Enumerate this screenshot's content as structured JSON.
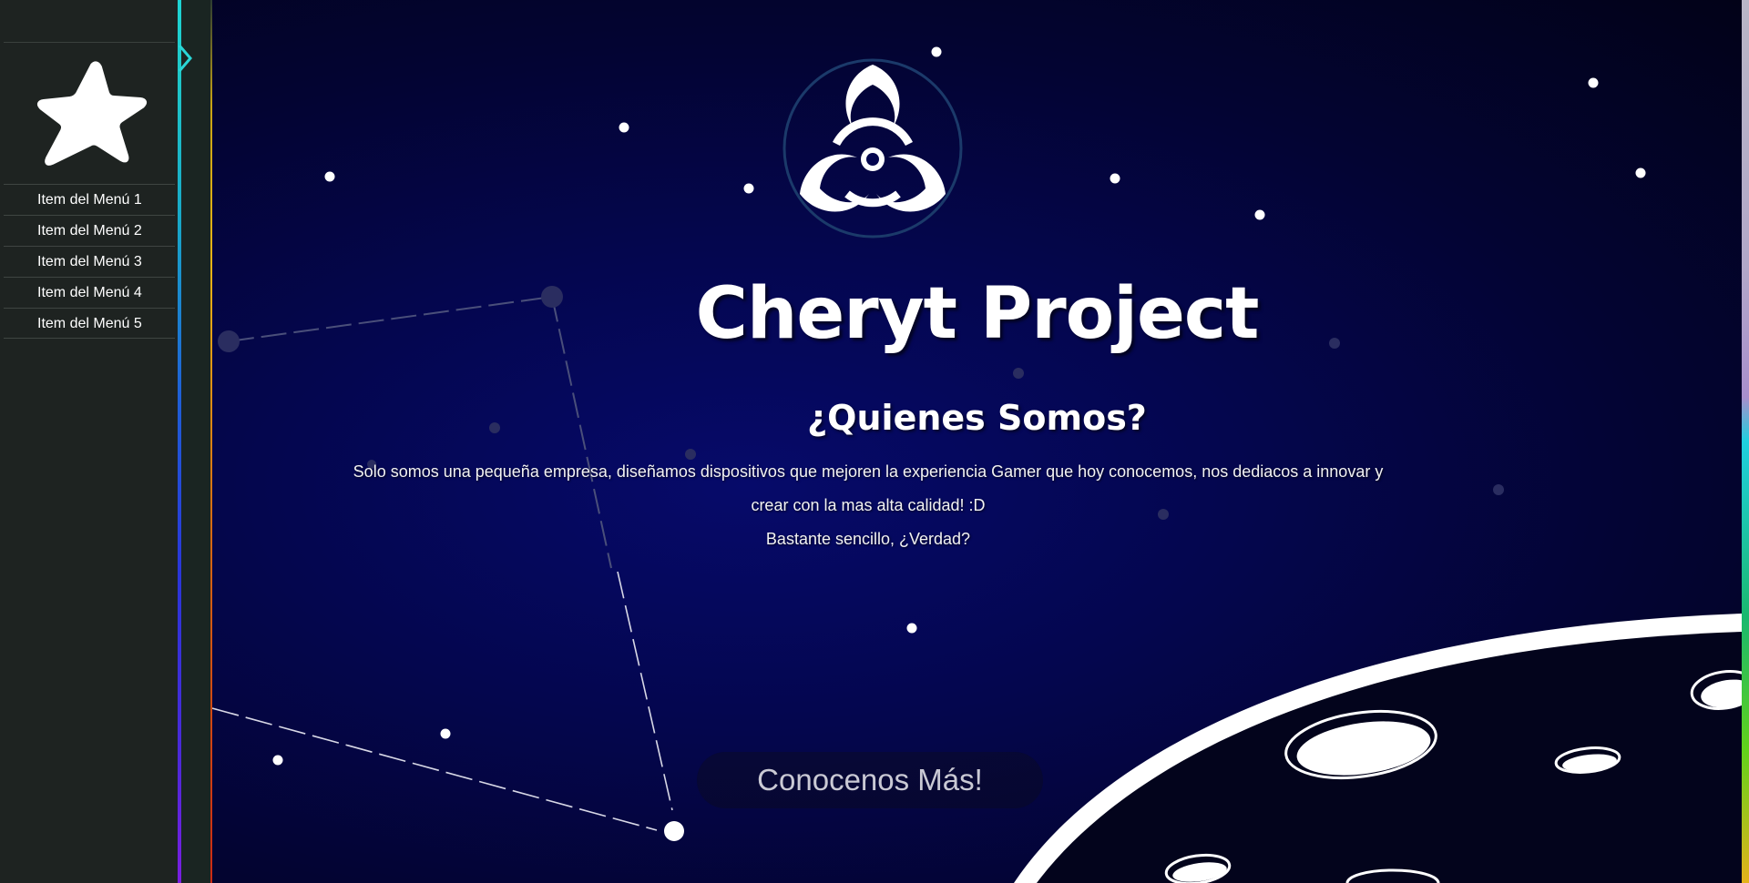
{
  "sidebar": {
    "logo": "star-icon",
    "items": [
      {
        "label": "Item del Menú 1"
      },
      {
        "label": "Item del Menú 2"
      },
      {
        "label": "Item del Menú 3"
      },
      {
        "label": "Item del Menú 4"
      },
      {
        "label": "Item del Menú 5"
      }
    ]
  },
  "hero": {
    "emblem": "biohazard-icon",
    "title": "Cheryt Project",
    "subtitle": "¿Quienes Somos?",
    "paragraph_line1": "Solo somos una pequeña empresa, diseñamos dispositivos que mejoren la experiencia Gamer que hoy conocemos, nos dediacos a innovar y",
    "paragraph_line2": "crear con la mas alta calidad! :D",
    "paragraph_line3": "Bastante sencillo, ¿Verdad?",
    "cta_label": "Conocenos Más!"
  },
  "colors": {
    "sidebar_bg": "#1e2321",
    "stage_bg": "#04064e",
    "accent_cyan": "#1ed4d4",
    "accent_purple": "#7a1ee0",
    "text": "#ffffff"
  }
}
